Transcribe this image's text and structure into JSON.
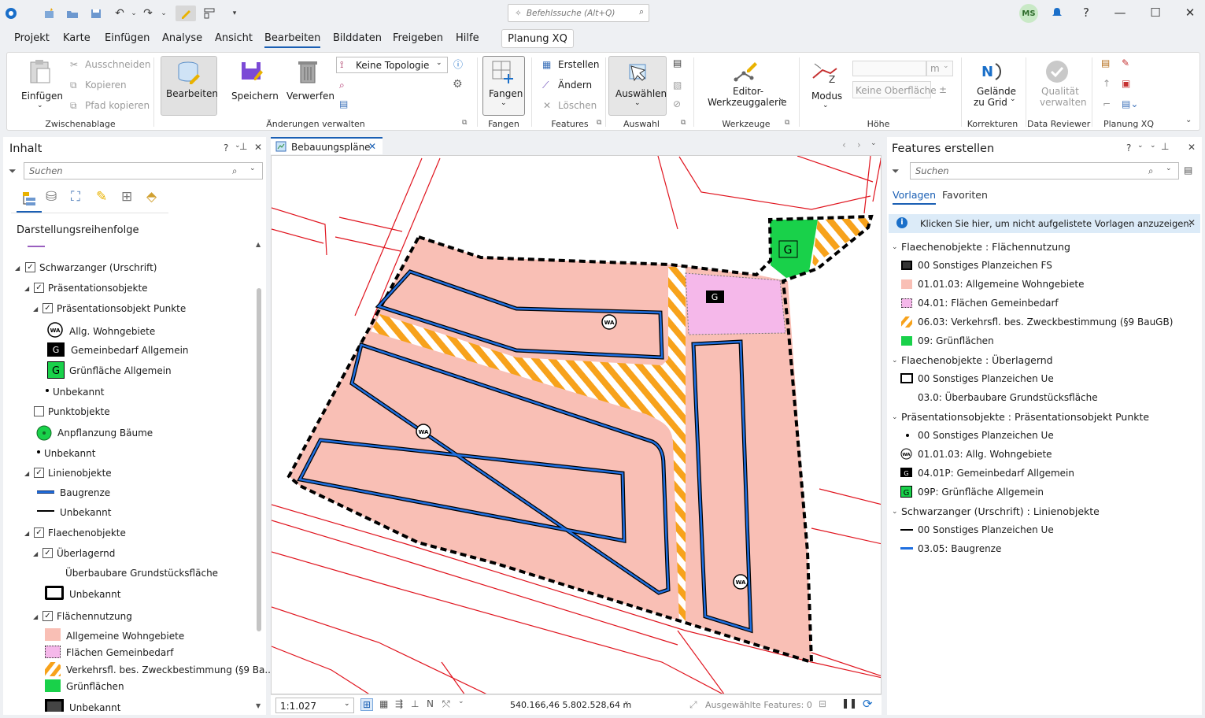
{
  "search": {
    "placeholder": "Befehlssuche (Alt+Q)"
  },
  "user": {
    "initials": "MS"
  },
  "menu": {
    "items": [
      "Projekt",
      "Karte",
      "Einfügen",
      "Analyse",
      "Ansicht",
      "Bearbeiten",
      "Bilddaten",
      "Freigeben",
      "Hilfe"
    ],
    "active": "Bearbeiten",
    "extra_tab": "Planung XQ"
  },
  "ribbon": {
    "clipboard": {
      "paste": "Einfügen",
      "cut": "Ausschneiden",
      "copy": "Kopieren",
      "copy_path": "Pfad kopieren",
      "group": "Zwischenablage"
    },
    "manage": {
      "edit": "Bearbeiten",
      "save": "Speichern",
      "discard": "Verwerfen",
      "topology": "Keine Topologie",
      "group": "Änderungen verwalten"
    },
    "snapping": {
      "label": "Fangen",
      "group": "Fangen"
    },
    "features": {
      "create": "Erstellen",
      "modify": "Ändern",
      "delete": "Löschen",
      "group": "Features"
    },
    "selection": {
      "select": "Auswählen",
      "group": "Auswahl"
    },
    "tools": {
      "line1": "Editor-",
      "line2": "Werkzeuggalerie",
      "group": "Werkzeuge"
    },
    "elevation": {
      "mode": "Modus",
      "surface": "Keine Oberfläche",
      "unit": "m",
      "group": "Höhe"
    },
    "corrections": {
      "line1": "Gelände",
      "line2": "zu Grid",
      "group": "Korrekturen"
    },
    "reviewer": {
      "line1": "Qualität",
      "line2": "verwalten",
      "group": "Data Reviewer"
    },
    "planung": {
      "group": "Planung XQ"
    }
  },
  "contents": {
    "title": "Inhalt",
    "search_placeholder": "Suchen",
    "heading": "Darstellungsreihenfolge",
    "items": [
      "Schwarzanger (Urschrift)",
      "Präsentationsobjekte",
      "Präsentationsobjekt Punkte",
      "Allg. Wohngebiete",
      "Gemeinbedarf Allgemein",
      "Grünfläche Allgemein",
      "Unbekannt",
      "Punktobjekte",
      "Anpflanzung Bäume",
      "Unbekannt",
      "Linienobjekte",
      "Baugrenze",
      "Unbekannt",
      "Flaechenobjekte",
      "Überlagernd",
      "Überbaubare Grundstücksfläche",
      "Unbekannt",
      "Flächennutzung",
      "Allgemeine Wohngebiete",
      "Flächen Gemeinbedarf",
      "Verkehrsfl. bes. Zweckbestimmung (§9 Ba...",
      "Grünflächen",
      "Unbekannt"
    ]
  },
  "map": {
    "tab": "Bebauungspläne",
    "scale": "1:1.027",
    "coords": "540.166,46 5.802.528,64 m",
    "selected": "Ausgewählte Features: 0",
    "label_wa": "WA",
    "label_g": "G"
  },
  "create": {
    "title": "Features erstellen",
    "search_placeholder": "Suchen",
    "tabs": [
      "Vorlagen",
      "Favoriten"
    ],
    "info": "Klicken Sie hier, um nicht aufgelistete Vorlagen anzuzeigen.",
    "groups": [
      {
        "title": "Flaechenobjekte : Flächennutzung",
        "items": [
          "00 Sonstiges Planzeichen FS",
          "01.01.03: Allgemeine Wohngebiete",
          "04.01: Flächen Gemeinbedarf",
          "06.03: Verkehrsfl. bes. Zweckbestimmung (§9 BauGB)",
          "09: Grünflächen"
        ]
      },
      {
        "title": "Flaechenobjekte : Überlagernd",
        "items": [
          "00 Sonstiges Planzeichen Ue",
          "03.0: Überbaubare Grundstücksfläche"
        ]
      },
      {
        "title": "Präsentationsobjekte : Präsentationsobjekt Punkte",
        "items": [
          "00 Sonstiges Planzeichen Ue",
          "01.01.03: Allg. Wohngebiete",
          "04.01P: Gemeinbedarf Allgemein",
          "09P: Grünfläche Allgemein"
        ]
      },
      {
        "title": "Schwarzanger (Urschrift) : Linienobjekte",
        "items": [
          "00 Sonstiges Planzeichen Ue",
          "03.05: Baugrenze"
        ]
      }
    ]
  },
  "colors": {
    "accent": "#1a5fb4",
    "wohngebiet": "#f9bfb5",
    "gemeinbedarf": "#f5b8ea",
    "gruen": "#19d14a",
    "verkehr": "#f7a21b",
    "baugrenze": "#1f6fe0",
    "parcel": "#e0141e"
  }
}
